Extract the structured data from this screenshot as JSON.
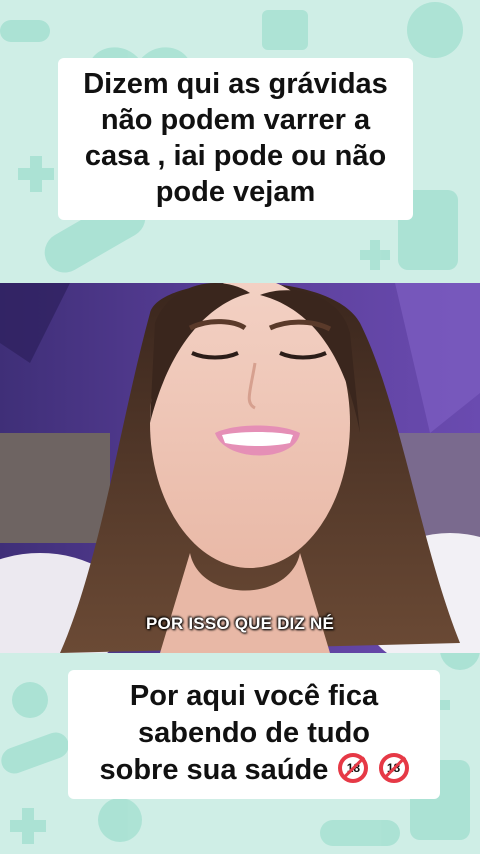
{
  "top_caption": {
    "lines": [
      "Dizem qui as grávidas",
      "não podem varrer a",
      "casa , iai pode ou não",
      "pode vejam"
    ]
  },
  "video": {
    "subtitle": "POR ISSO QUE DIZ NÉ"
  },
  "bottom_caption": {
    "lines": [
      "Por aqui você fica",
      "sabendo de tudo",
      "sobre sua saúde"
    ],
    "badges": [
      {
        "icon": "no-under-18-icon",
        "text": "18"
      },
      {
        "icon": "no-under-18-icon",
        "text": "18"
      }
    ]
  },
  "colors": {
    "background": "#cfeee6",
    "pattern": "#9fdccd",
    "badge_red": "#e63946"
  }
}
